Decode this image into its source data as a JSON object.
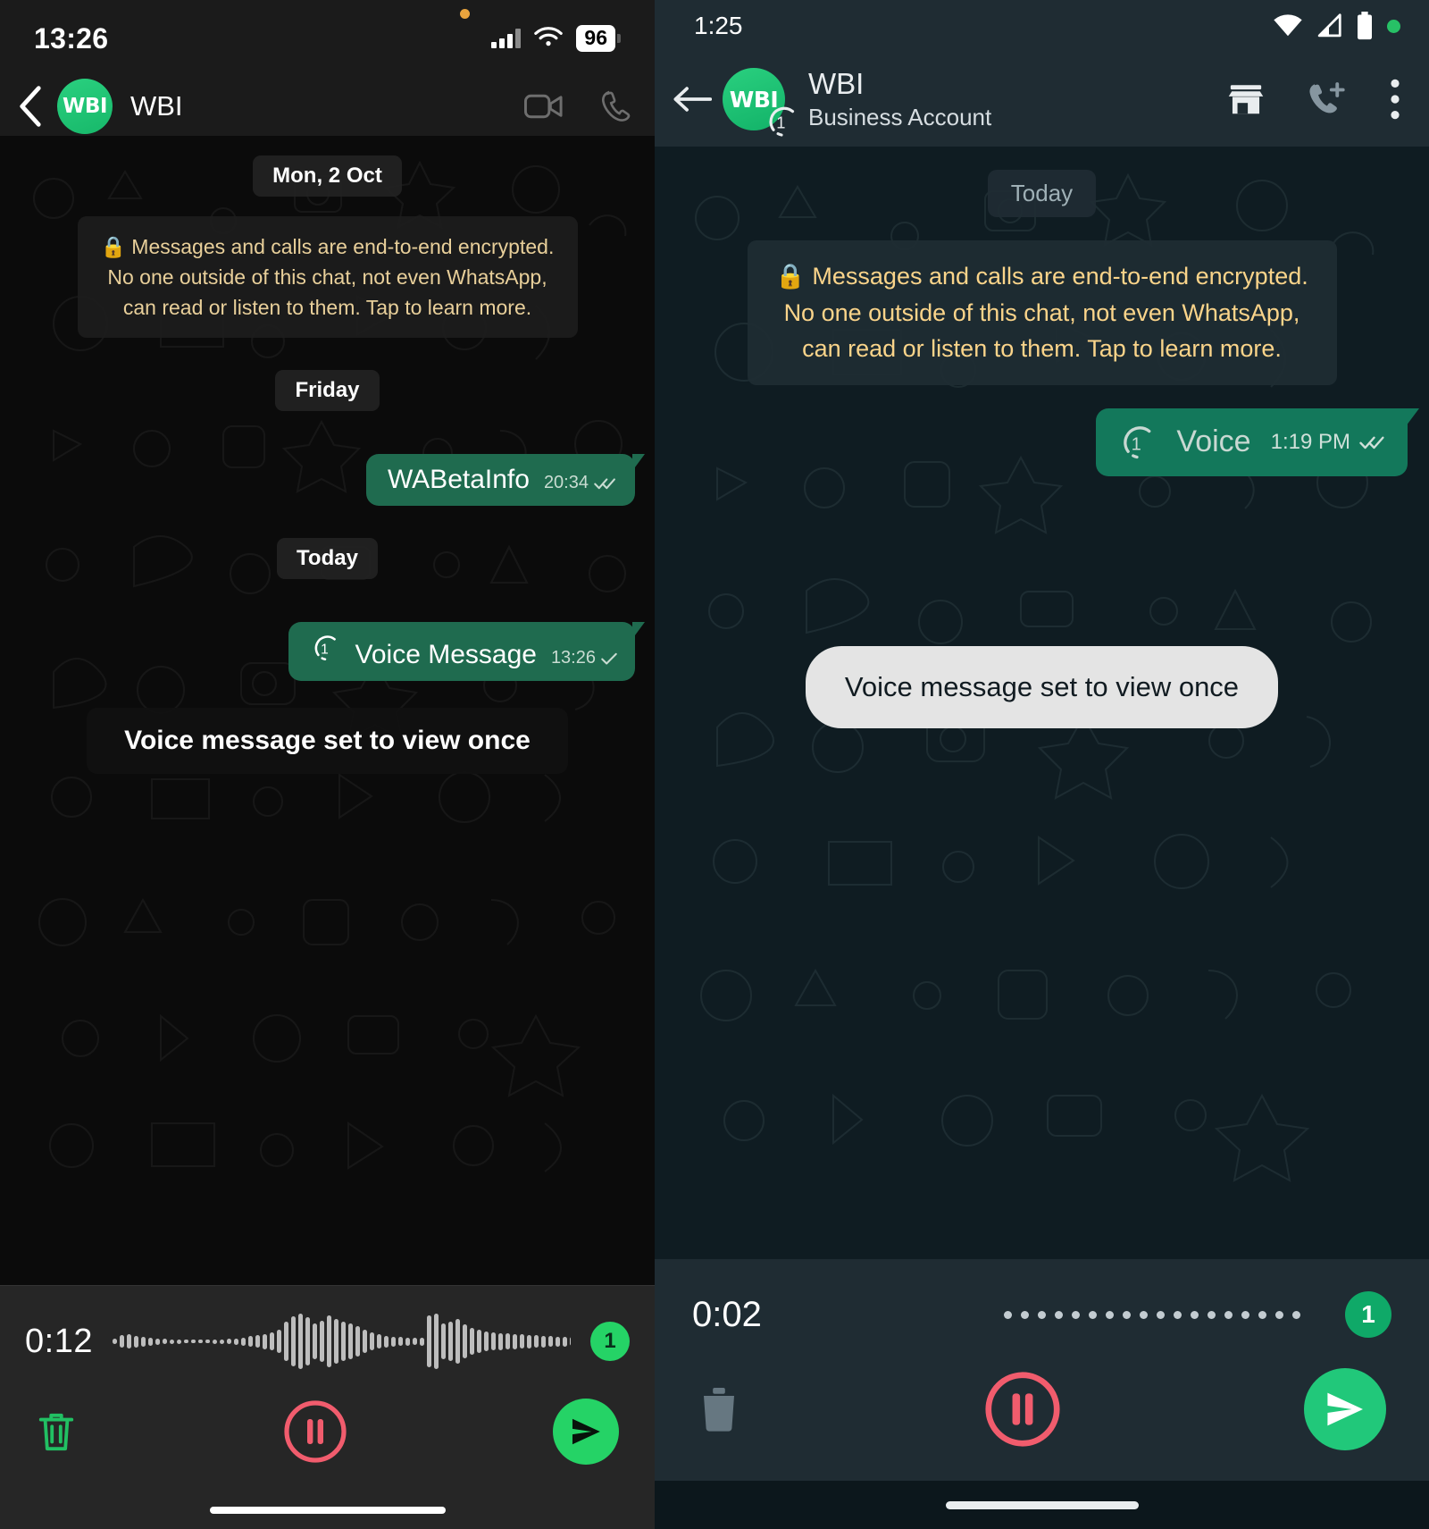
{
  "left_panel": {
    "platform": "ios",
    "status_bar": {
      "time": "13:26",
      "battery": "96",
      "wifi_icon": "wifi-icon",
      "signal_icon": "cellular-signal-icon",
      "privacy_dot": "orange-recording-dot"
    },
    "header": {
      "back_icon": "chevron-left-icon",
      "avatar_label": "WBI",
      "contact_name": "WBI",
      "video_call_icon": "video-camera-icon",
      "voice_call_icon": "phone-icon"
    },
    "chat": {
      "day_divider_1": "Mon, 2 Oct",
      "encryption_notice": "Messages and calls are end-to-end encrypted. No one outside of this chat, not even WhatsApp, can read or listen to them. Tap to learn more.",
      "lock_icon": "lock-icon",
      "day_divider_2": "Friday",
      "day_divider_3": "Today",
      "messages": [
        {
          "text": "WABetaInfo",
          "time": "20:34",
          "status_icon": "double-check-icon",
          "direction": "outgoing"
        },
        {
          "text": "Voice Message",
          "time": "13:26",
          "status_icon": "single-check-icon",
          "direction": "outgoing",
          "view_once_icon": "view-once-audio-icon"
        }
      ],
      "toast": "Voice message set to view once"
    },
    "recorder": {
      "elapsed": "0:12",
      "waveform_icon": "audio-waveform",
      "view_once_badge": "1",
      "delete_icon": "trash-icon",
      "pause_icon": "pause-circle-icon",
      "send_icon": "send-icon"
    }
  },
  "right_panel": {
    "platform": "android",
    "status_bar": {
      "time": "1:25",
      "wifi_icon": "wifi-icon",
      "signal_icon": "cellular-signal-icon",
      "battery_icon": "battery-full-icon",
      "privacy_dot": "green-recording-dot"
    },
    "header": {
      "back_icon": "arrow-left-icon",
      "avatar_label": "WBI",
      "contact_name": "WBI",
      "subtitle": "Business Account",
      "view_once_ring_icon": "view-once-audio-icon",
      "business_icon": "storefront-icon",
      "add_call_icon": "phone-add-icon",
      "overflow_icon": "more-vertical-icon"
    },
    "chat": {
      "day_divider": "Today",
      "encryption_notice": "Messages and calls are end-to-end encrypted. No one outside of this chat, not even WhatsApp, can read or listen to them. Tap to learn more.",
      "lock_icon": "lock-icon",
      "messages": [
        {
          "text": "Voice",
          "time": "1:19 PM",
          "status_icon": "double-check-icon",
          "direction": "outgoing",
          "view_once_icon": "view-once-audio-icon"
        }
      ],
      "toast": "Voice message set to view once"
    },
    "recorder": {
      "elapsed": "0:02",
      "waveform_icon": "audio-dots",
      "view_once_badge": "1",
      "delete_icon": "trash-icon",
      "pause_icon": "pause-circle-icon",
      "send_icon": "send-icon"
    }
  },
  "colors": {
    "whatsapp_green": "#25d366",
    "bubble_out_ios": "#1f6b4f",
    "bubble_out_android": "#13785b",
    "encryption_text": "#e8cf9a",
    "record_red": "#f15c6d",
    "android_surface": "#1f2c33"
  }
}
